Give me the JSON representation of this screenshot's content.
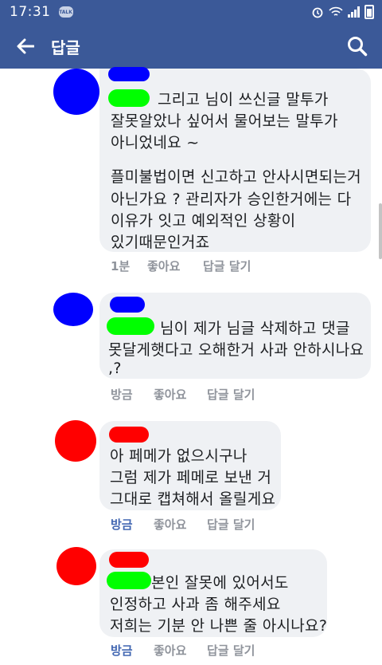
{
  "status_bar": {
    "time": "17:31",
    "talk_badge": "TALK"
  },
  "header": {
    "title": "답글"
  },
  "colors": {
    "brand": "#3b5998",
    "bubble": "#eff1f4",
    "redact_green": "#00ff00",
    "redact_blue": "#0000ff",
    "redact_red": "#ff0000",
    "link_blue": "#4267b2"
  },
  "comments": [
    {
      "lines": [
        "그리고 님이 쓰신글 말투가",
        "잘못알았나 싶어서 물어보는 말투가",
        "아니었네요 ~",
        "",
        "플미불법이면 신고하고 안사시면되는거",
        "아닌가요 ? 관리자가 승인한거에는 다",
        "이유가 잇고 예외적인 상황이",
        "있기때문인거죠"
      ],
      "time": "1분",
      "like": "좋아요",
      "reply": "답글 달기"
    },
    {
      "lines": [
        "님이 제가 님글 삭제하고 댓글",
        "못달게햇다고 오해한거 사과 안하시나요",
        ",?"
      ],
      "time": "방금",
      "like": "좋아요",
      "reply": "답글 달기"
    },
    {
      "lines": [
        "아 페메가 없으시구나",
        "그럼 제가 페메로 보낸 거",
        "그대로 캡쳐해서 올릴게요"
      ],
      "time": "방금",
      "like": "좋아요",
      "reply": "답글 달기"
    },
    {
      "lines": [
        "본인 잘못에 있어서도",
        "인정하고 사과 좀 해주세요",
        "저희는 기분 안 나쁜 줄 아시나요?"
      ],
      "time": "방금",
      "like": "좋아요",
      "reply": "답글 달기"
    }
  ]
}
